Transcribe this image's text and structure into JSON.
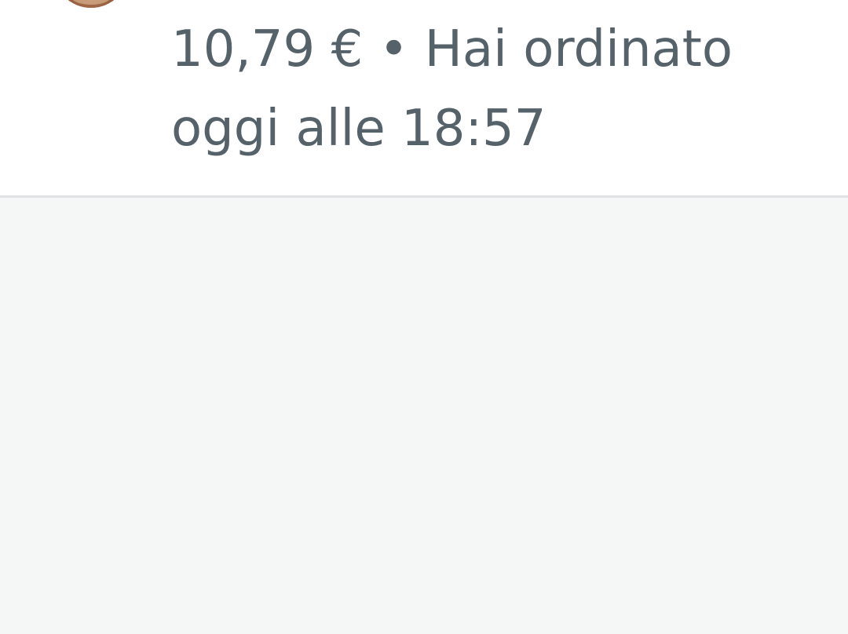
{
  "order": {
    "price": "10,79 €",
    "separator": "•",
    "line1_rest": "Hai ordinato",
    "line2": "oggi alle 18:57",
    "thumbnail_icon": "food-thumbnail"
  },
  "colors": {
    "text": "#56626a",
    "card_background": "#ffffff",
    "page_background": "#f5f7f7",
    "divider": "#dfe3e3"
  }
}
